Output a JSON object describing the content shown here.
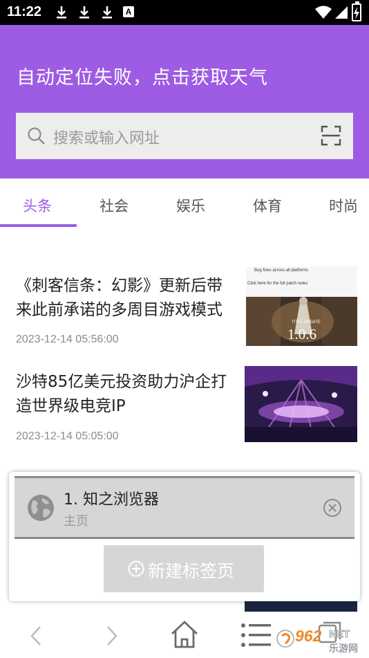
{
  "status_bar": {
    "time": "11:22",
    "icons": [
      "download-icon",
      "download-icon",
      "download-icon",
      "a-notification-icon",
      "wifi-icon",
      "signal-icon",
      "battery-charging-icon"
    ],
    "a_badge": "A"
  },
  "header": {
    "weather_text": "自动定位失败，点击获取天气",
    "background_color": "#9d5ce3"
  },
  "search": {
    "placeholder": "搜索或输入网址"
  },
  "tabs": {
    "items": [
      "头条",
      "社会",
      "娱乐",
      "体育",
      "时尚"
    ],
    "active_index": 0,
    "accent_color": "#9d5ce3"
  },
  "articles": [
    {
      "title": "《刺客信条：幻影》更新后带来此前承诺的多周目游戏模式",
      "time": "2023-12-14 05:56:00",
      "thumb_lines": [
        "Bug fixes across all platforms",
        "Click here for the full patch notes",
        "TITLE UPDATE",
        "1.0.6"
      ]
    },
    {
      "title": "沙特85亿美元投资助力沪企打造世界级电竞IP",
      "time": "2023-12-14 05:05:00"
    }
  ],
  "tab_manager": {
    "tab_title": "1. 知之浏览器",
    "tab_subtitle": "主页",
    "new_tab_label": "新建标签页"
  },
  "toolbar": {
    "icons": [
      "back-icon",
      "forward-icon",
      "home-icon",
      "menu-icon",
      "tabs-icon"
    ]
  },
  "watermark": {
    "text_main": "962",
    "text_net": "NET",
    "text_sub": "乐游网"
  }
}
